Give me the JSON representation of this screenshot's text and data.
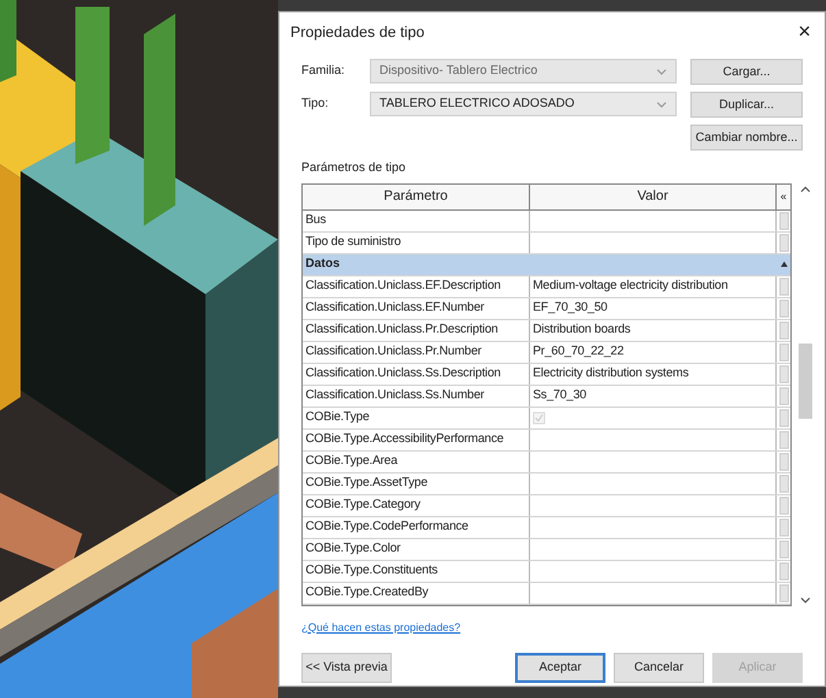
{
  "dialog": {
    "title": "Propiedades de tipo",
    "close": "×"
  },
  "fields": [
    {
      "label": "Familia:",
      "value": "Dispositivo- Tablero Electrico",
      "disabled": true
    },
    {
      "label": "Tipo:",
      "value": "TABLERO ELECTRICO ADOSADO",
      "disabled": false
    }
  ],
  "side_buttons": [
    "Cargar...",
    "Duplicar...",
    "Cambiar nombre..."
  ],
  "section_label": "Parámetros de tipo",
  "table": {
    "columns": [
      "Parámetro",
      "Valor",
      "«"
    ],
    "rows": [
      {
        "kind": "param",
        "name": "Bus"
      },
      {
        "kind": "param",
        "name": "Tipo de suministro"
      },
      {
        "kind": "group",
        "name": "Datos",
        "expanded": true
      },
      {
        "kind": "param",
        "name": "Classification.Uniclass.EF.Description",
        "value": "Medium-voltage electricity distribution"
      },
      {
        "kind": "param",
        "name": "Classification.Uniclass.EF.Number",
        "value": "EF_70_30_50"
      },
      {
        "kind": "param",
        "name": "Classification.Uniclass.Pr.Description",
        "value": "Distribution boards"
      },
      {
        "kind": "param",
        "name": "Classification.Uniclass.Pr.Number",
        "value": "Pr_60_70_22_22"
      },
      {
        "kind": "param",
        "name": "Classification.Uniclass.Ss.Description",
        "value": "Electricity distribution systems"
      },
      {
        "kind": "param",
        "name": "Classification.Uniclass.Ss.Number",
        "value": "Ss_70_30"
      },
      {
        "kind": "check",
        "name": "COBie.Type",
        "checked": true,
        "disabled": true
      },
      {
        "kind": "param",
        "name": "COBie.Type.AccessibilityPerformance"
      },
      {
        "kind": "param",
        "name": "COBie.Type.Area"
      },
      {
        "kind": "param",
        "name": "COBie.Type.AssetType"
      },
      {
        "kind": "param",
        "name": "COBie.Type.Category"
      },
      {
        "kind": "param",
        "name": "COBie.Type.CodePerformance"
      },
      {
        "kind": "param",
        "name": "COBie.Type.Color"
      },
      {
        "kind": "param",
        "name": "COBie.Type.Constituents"
      },
      {
        "kind": "param",
        "name": "COBie.Type.CreatedBy"
      }
    ]
  },
  "help_link": "¿Qué hacen estas propiedades?",
  "buttons": [
    {
      "label": "<< Vista previa",
      "kind": "preview",
      "disabled": false,
      "focused": false
    },
    {
      "label": "Aceptar",
      "kind": "action",
      "disabled": false,
      "focused": true
    },
    {
      "label": "Cancelar",
      "kind": "action",
      "disabled": false,
      "focused": false
    },
    {
      "label": "Aplicar",
      "kind": "action",
      "disabled": true,
      "focused": false
    }
  ]
}
